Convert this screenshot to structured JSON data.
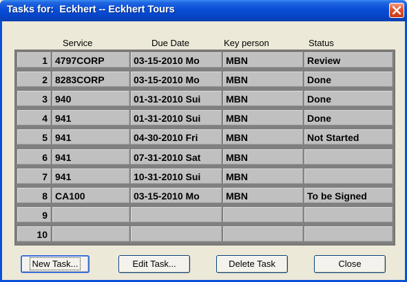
{
  "window": {
    "title": "Tasks for:  Eckhert -- Eckhert Tours"
  },
  "columns": {
    "service": "Service",
    "due_date": "Due Date",
    "key_person": "Key person",
    "status": "Status"
  },
  "rows": [
    {
      "num": "1",
      "service": "4797CORP",
      "due_date": "03-15-2010 Mo",
      "key_person": "MBN",
      "status": "Review"
    },
    {
      "num": "2",
      "service": "8283CORP",
      "due_date": "03-15-2010 Mo",
      "key_person": "MBN",
      "status": "Done"
    },
    {
      "num": "3",
      "service": "940",
      "due_date": "01-31-2010 Sui",
      "key_person": "MBN",
      "status": "Done"
    },
    {
      "num": "4",
      "service": "941",
      "due_date": "01-31-2010 Sui",
      "key_person": "MBN",
      "status": "Done"
    },
    {
      "num": "5",
      "service": "941",
      "due_date": "04-30-2010 Fri",
      "key_person": "MBN",
      "status": "Not Started"
    },
    {
      "num": "6",
      "service": "941",
      "due_date": "07-31-2010 Sat",
      "key_person": "MBN",
      "status": ""
    },
    {
      "num": "7",
      "service": "941",
      "due_date": "10-31-2010 Sui",
      "key_person": "MBN",
      "status": ""
    },
    {
      "num": "8",
      "service": "CA100",
      "due_date": "03-15-2010 Mo",
      "key_person": "MBN",
      "status": "To be Signed"
    },
    {
      "num": "9",
      "service": "",
      "due_date": "",
      "key_person": "",
      "status": ""
    },
    {
      "num": "10",
      "service": "",
      "due_date": "",
      "key_person": "",
      "status": ""
    }
  ],
  "buttons": {
    "new_task": "New Task...",
    "edit_task": "Edit Task...",
    "delete_task": "Delete Task",
    "close": "Close"
  },
  "icons": {
    "close": "close-icon"
  },
  "colors": {
    "titlebar": "#0a4fd8",
    "close_button": "#e0532d",
    "cell_bg": "#c0c0c0",
    "grid_bg": "#808080",
    "dialog_bg": "#ece9d8"
  }
}
